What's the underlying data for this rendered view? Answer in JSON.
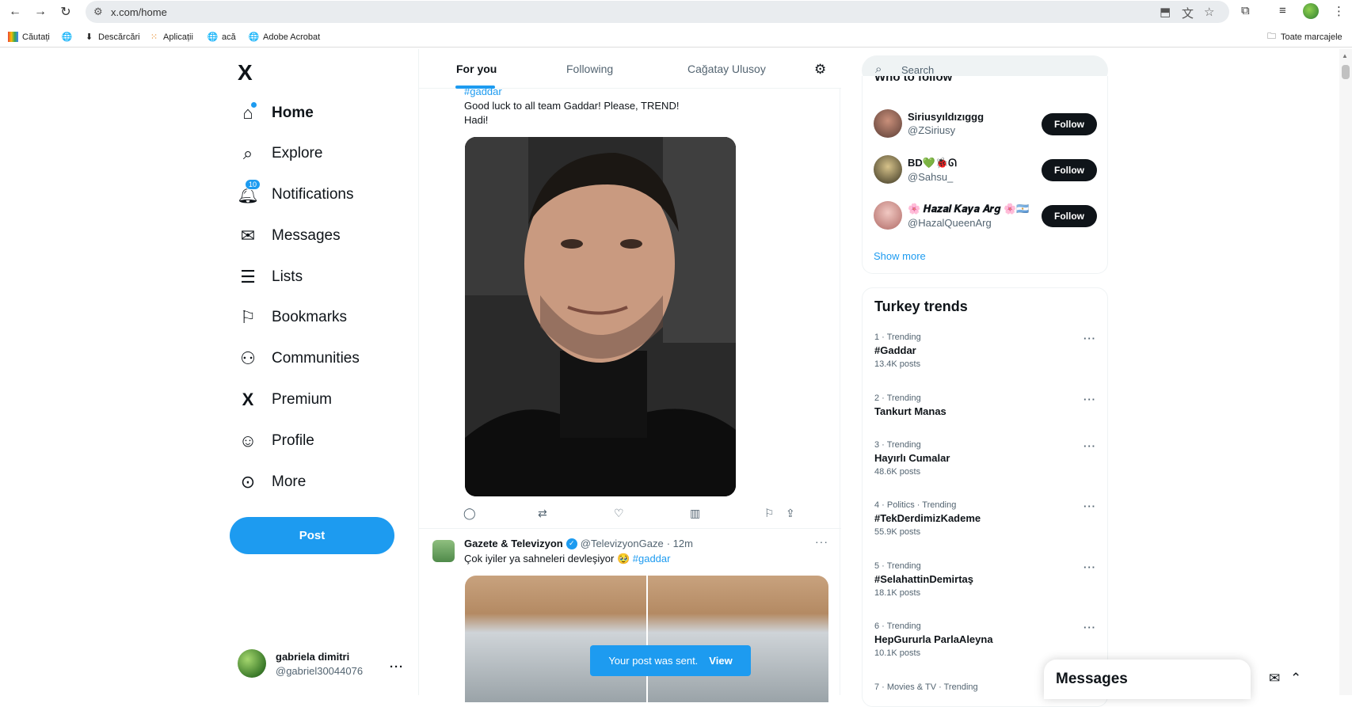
{
  "browser": {
    "url": "x.com/home",
    "bookmarks": [
      "Căutați",
      "Descărcări",
      "Aplicații",
      "acă",
      "Adobe Acrobat"
    ],
    "all_bookmarks": "Toate marcajele"
  },
  "sidebar": {
    "logo": "X",
    "items": [
      {
        "label": "Home",
        "icon": "home-icon"
      },
      {
        "label": "Explore",
        "icon": "search-icon"
      },
      {
        "label": "Notifications",
        "icon": "bell-icon",
        "badge": "10"
      },
      {
        "label": "Messages",
        "icon": "envelope-icon"
      },
      {
        "label": "Lists",
        "icon": "list-icon"
      },
      {
        "label": "Bookmarks",
        "icon": "bookmark-icon"
      },
      {
        "label": "Communities",
        "icon": "communities-icon"
      },
      {
        "label": "Premium",
        "icon": "x-icon"
      },
      {
        "label": "Profile",
        "icon": "person-icon"
      },
      {
        "label": "More",
        "icon": "more-circle-icon"
      }
    ],
    "post_label": "Post",
    "account": {
      "name": "gabriela dimitri",
      "handle": "@gabriel30044076"
    }
  },
  "timeline": {
    "tabs": [
      "For you",
      "Following",
      "Cağatay Ulusoy"
    ],
    "tweet1": {
      "hashtag": "#gaddar",
      "line1": "Good luck to all team Gaddar!  Please, TREND!",
      "line2": "Hadi!"
    },
    "tweet2": {
      "name": "Gazete & Televizyon",
      "handle": "@TelevizyonGaze",
      "time": "· 12m",
      "text": "Çok iyiler ya sahneleri  devleşiyor",
      "emoji": "🥹",
      "hashtag": "#gaddar"
    }
  },
  "toast": {
    "message": "Your post was sent.",
    "action": "View"
  },
  "search": {
    "placeholder": "Search"
  },
  "who_to_follow": {
    "title_cut": "Who to follow",
    "accounts": [
      {
        "name": "Siriusyıldızıggg",
        "handle": "@ZSiriusy"
      },
      {
        "name": "BD💚🐞ᘏ",
        "handle": "@Sahsu_"
      },
      {
        "name": "🌸 𝑯𝒂𝒛𝒂𝒍 𝑲𝒂𝒚𝒂 𝑨𝒓𝒈 🌸🇦🇷",
        "handle": "@HazalQueenArg"
      }
    ],
    "follow_label": "Follow",
    "show_more": "Show more"
  },
  "trends": {
    "title": "Turkey trends",
    "items": [
      {
        "meta": "1 · Trending",
        "name": "#Gaddar",
        "posts": "13.4K posts"
      },
      {
        "meta": "2 · Trending",
        "name": "Tankurt Manas",
        "posts": ""
      },
      {
        "meta": "3 · Trending",
        "name": "Hayırlı Cumalar",
        "posts": "48.6K posts"
      },
      {
        "meta": "4 · Politics · Trending",
        "name": "#TekDerdimizKademe",
        "posts": "55.9K posts"
      },
      {
        "meta": "5 · Trending",
        "name": "#SelahattinDemirtaş",
        "posts": "18.1K posts"
      },
      {
        "meta": "6 · Trending",
        "name": "HepGururla ParlaAleyna",
        "posts": "10.1K posts"
      },
      {
        "meta": "7 · Movies & TV · Trending",
        "name": "",
        "posts": ""
      }
    ]
  },
  "messages_drawer": {
    "title": "Messages"
  },
  "colors": {
    "accent": "#1d9bf0",
    "text": "#0f1419",
    "muted": "#536471"
  }
}
